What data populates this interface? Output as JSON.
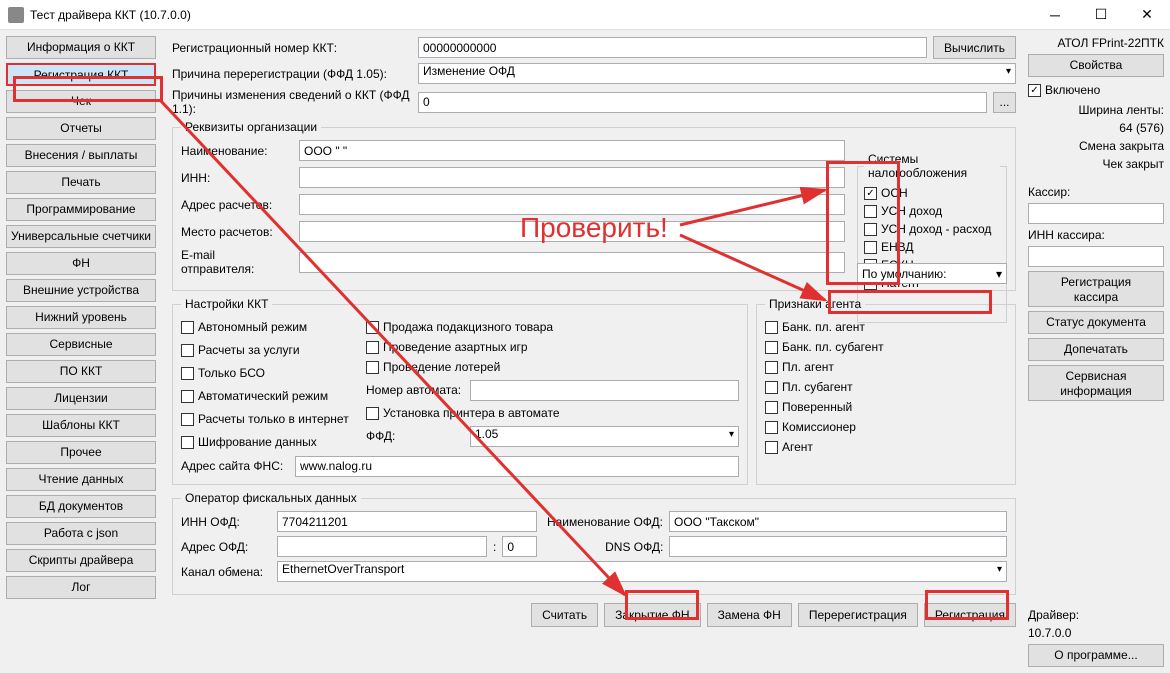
{
  "window_title": "Тест драйвера ККТ (10.7.0.0)",
  "nav": [
    "Информация о ККТ",
    "Регистрация ККТ",
    "Чек",
    "Отчеты",
    "Внесения / выплаты",
    "Печать",
    "Программирование",
    "Универсальные счетчики",
    "ФН",
    "Внешние устройства",
    "Нижний уровень",
    "Сервисные",
    "ПО ККТ",
    "Лицензии",
    "Шаблоны ККТ",
    "Прочее",
    "Чтение данных",
    "БД документов",
    "Работа с json",
    "Скрипты драйвера",
    "Лог"
  ],
  "nav_active": 1,
  "reg_num_label": "Регистрационный номер ККТ:",
  "reg_num_value": "00000000000",
  "calc_btn": "Вычислить",
  "rereg_reason_label": "Причина перерегистрации (ФФД 1.05):",
  "rereg_reason_value": "Изменение ОФД",
  "change_reason_label": "Причины изменения сведений о ККТ (ФФД 1.1):",
  "change_reason_value": "0",
  "ellipsis": "...",
  "org_legend": "Реквизиты организации",
  "org": {
    "name_lbl": "Наименование:",
    "name_val": "ООО \" \"",
    "inn_lbl": "ИНН:",
    "inn_val": "",
    "addr_lbl": "Адрес расчетов:",
    "addr_val": "",
    "place_lbl": "Место расчетов:",
    "place_val": "",
    "email_lbl": "E-mail отправителя:",
    "email_val": ""
  },
  "tax_legend": "Системы налогообложения",
  "tax_items": [
    {
      "label": "ОСН",
      "checked": true
    },
    {
      "label": "УСН доход",
      "checked": false
    },
    {
      "label": "УСН доход - расход",
      "checked": false
    },
    {
      "label": "ЕНВД",
      "checked": false
    },
    {
      "label": "ЕСХН",
      "checked": false
    },
    {
      "label": "Патент",
      "checked": false
    }
  ],
  "default_sel": "По умолчанию:",
  "kkt_legend": "Настройки ККТ",
  "kkt_col1": [
    "Автономный режим",
    "Расчеты за услуги",
    "Только БСО",
    "Автоматический режим",
    "Расчеты только в интернет",
    "Шифрование данных"
  ],
  "kkt_col2": [
    "Продажа подакцизного товара",
    "Проведение азартных игр",
    "Проведение лотерей"
  ],
  "automat_lbl": "Номер автомата:",
  "printer_lbl": "Установка принтера в автомате",
  "ffd_lbl": "ФФД:",
  "ffd_val": "1.05",
  "fns_lbl": "Адрес сайта ФНС:",
  "fns_val": "www.nalog.ru",
  "agent_legend": "Признаки агента",
  "agent_items": [
    "Банк. пл. агент",
    "Банк. пл. субагент",
    "Пл. агент",
    "Пл. субагент",
    "Поверенный",
    "Комиссионер",
    "Агент"
  ],
  "ofd_legend": "Оператор фискальных данных",
  "ofd": {
    "inn_lbl": "ИНН ОФД:",
    "inn_val": "7704211201",
    "name_lbl": "Наименование ОФД:",
    "name_val": "ООО \"Такском\"",
    "addr_lbl": "Адрес ОФД:",
    "addr_val": "",
    "port_val": "0",
    "dns_lbl": "DNS ОФД:",
    "dns_val": "",
    "channel_lbl": "Канал обмена:",
    "channel_val": "EthernetOverTransport"
  },
  "actions": [
    "Считать",
    "Закрытие ФН",
    "Замена ФН",
    "Перерегистрация",
    "Регистрация"
  ],
  "right": {
    "model": "АТОЛ FPrint-22ПТК",
    "props_btn": "Свойства",
    "enabled_lbl": "Включено",
    "width1": "Ширина ленты:",
    "width2": "64 (576)",
    "shift": "Смена закрыта",
    "check": "Чек закрыт",
    "cashier_lbl": "Кассир:",
    "cashier_inn_lbl": "ИНН кассира:",
    "reg_cashier": "Регистрация\nкассира",
    "doc_status": "Статус документа",
    "reprint": "Допечатать",
    "service_info": "Сервисная\nинформация",
    "driver_lbl": "Драйвер:",
    "driver_ver": "10.7.0.0",
    "about": "О программе..."
  },
  "annotation_text": "Проверить!"
}
